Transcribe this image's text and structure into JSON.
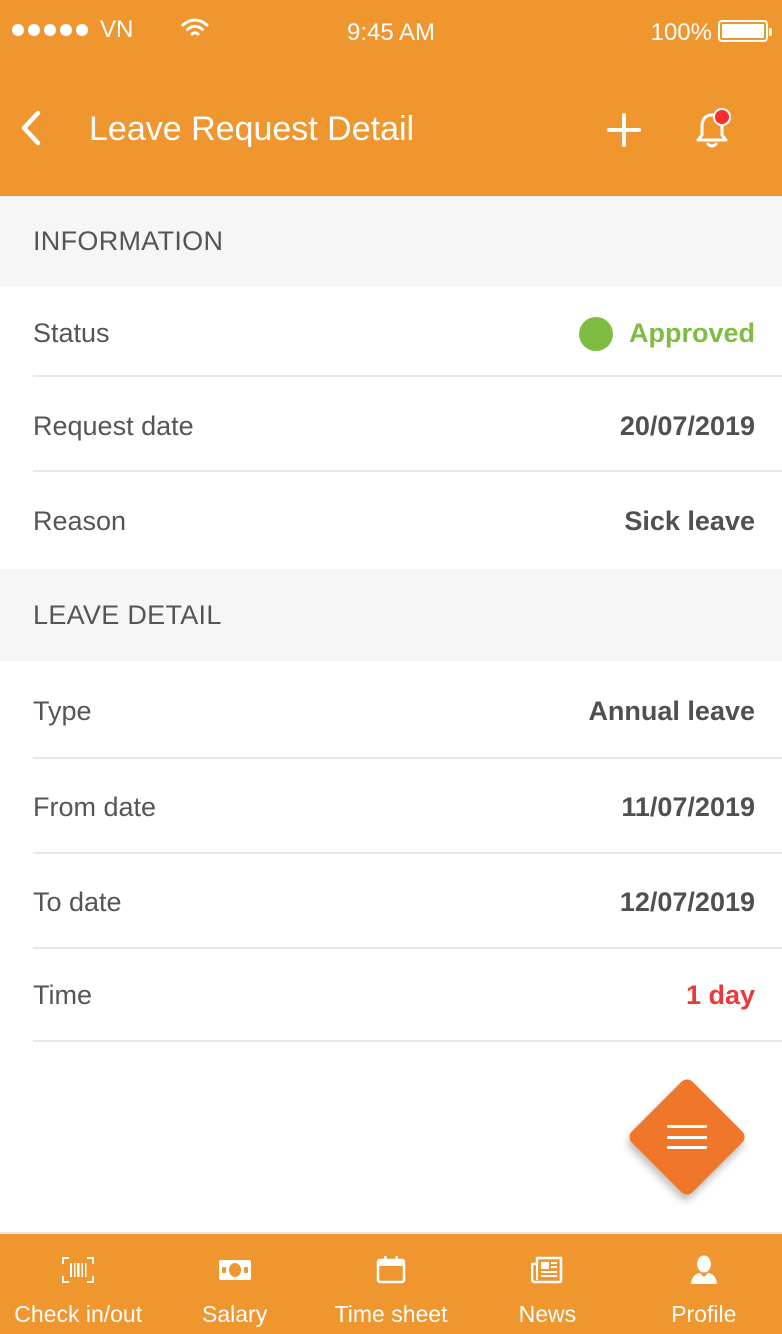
{
  "status_bar": {
    "carrier": "VN",
    "time": "9:45 AM",
    "battery": "100%"
  },
  "header": {
    "title": "Leave Request Detail",
    "back_icon": "chevron-left-icon",
    "add_icon": "plus-icon",
    "notification_icon": "bell-icon",
    "notification_badge_color": "#ff2d2d"
  },
  "information": {
    "section_title": "INFORMATION",
    "rows": [
      {
        "label": "Status",
        "value": "Approved"
      },
      {
        "label": "Request date",
        "value": "20/07/2019"
      },
      {
        "label": "Reason",
        "value": "Sick leave"
      }
    ]
  },
  "leave_detail": {
    "section_title": "LEAVE DETAIL",
    "rows": [
      {
        "label": "Type",
        "value": "Annual leave"
      },
      {
        "label": "From date",
        "value": "11/07/2019"
      },
      {
        "label": "To date",
        "value": "12/07/2019"
      },
      {
        "label": "Time",
        "value": "1 day"
      }
    ]
  },
  "fab": {
    "icon": "menu-icon"
  },
  "bottom_nav": {
    "tabs": [
      {
        "label": "Check in/out",
        "icon": "barcode-icon"
      },
      {
        "label": "Salary",
        "icon": "money-icon"
      },
      {
        "label": "Time sheet",
        "icon": "calendar-icon"
      },
      {
        "label": "News",
        "icon": "newspaper-icon"
      },
      {
        "label": "Profile",
        "icon": "user-icon"
      }
    ]
  },
  "colors": {
    "primary": "#f0962e",
    "fab": "#f0772a",
    "approved": "#7ebd42",
    "time_value": "#e83a3a",
    "section_background": "#f6f6f6"
  }
}
